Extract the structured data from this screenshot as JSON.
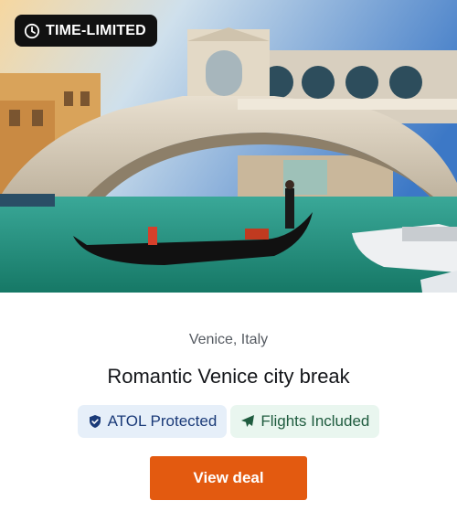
{
  "badge": {
    "label": "TIME-LIMITED",
    "icon": "clock-icon"
  },
  "deal": {
    "location": "Venice, Italy",
    "title": "Romantic Venice city break",
    "tags": [
      {
        "label": "ATOL Protected",
        "icon": "shield-icon",
        "color": "#1a3a78",
        "background": "#e6eff9"
      },
      {
        "label": "Flights Included",
        "icon": "airplane-icon",
        "color": "#1f5c3f",
        "background": "#e9f6ef"
      }
    ],
    "cta_label": "View deal"
  },
  "colors": {
    "accent": "#e35a10",
    "badge_bg": "#111111"
  }
}
